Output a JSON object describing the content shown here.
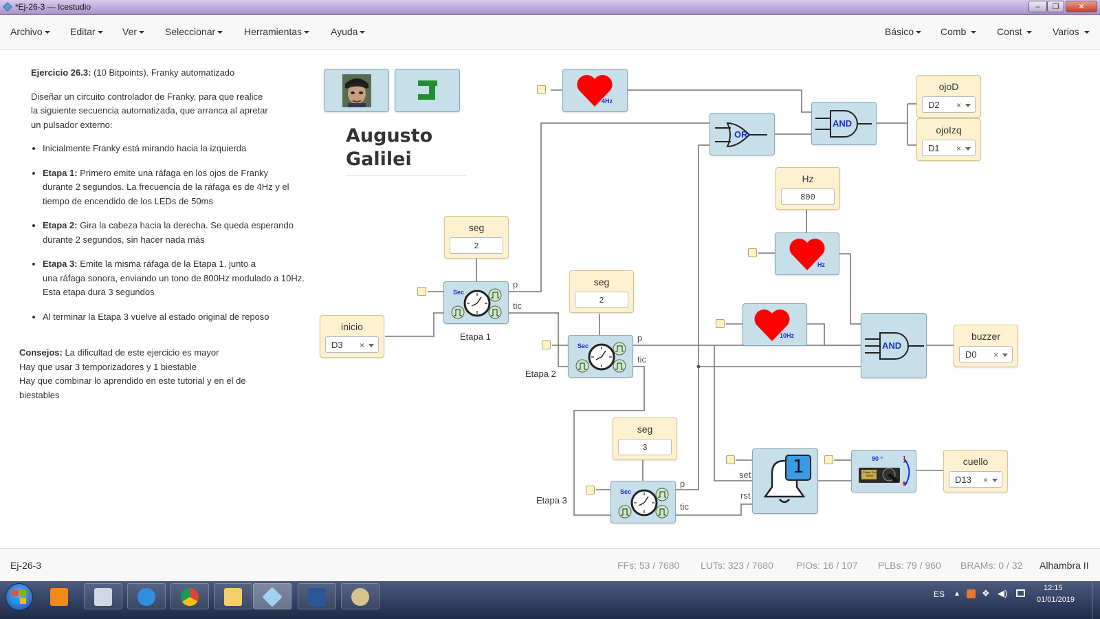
{
  "window": {
    "title": "*Ej-26-3 — Icestudio"
  },
  "menu_left": [
    "Archivo",
    "Editar",
    "Ver",
    "Seleccionar",
    "Herramientas",
    "Ayuda"
  ],
  "menu_right": [
    "Básico",
    "Comb",
    "Const",
    "Varios"
  ],
  "info": {
    "title_bold": "Ejercicio 26.3:",
    "title_rest": " (10 Bitpoints). Franky automatizado",
    "desc_lines": [
      "Diseñar un circuito controlador de Franky, para que realice",
      "la siguiente secuencia automatizada, que arranca al apretar",
      "un pulsador externo:"
    ],
    "bullets": [
      {
        "bold": "",
        "lines": [
          "Inicialmente Franky está mirando hacia la izquierda"
        ]
      },
      {
        "bold": "Etapa 1:",
        "lines": [
          " Primero emite una ráfaga en los ojos de Franky",
          "durante 2 segundos. La frecuencia de la ráfaga es de 4Hz y el",
          "tiempo de encendido de los LEDs de 50ms"
        ]
      },
      {
        "bold": "Etapa 2:",
        "lines": [
          " Gira la cabeza hacia la derecha. Se queda esperando",
          "durante 2 segundos, sin hacer nada más"
        ]
      },
      {
        "bold": "Etapa 3:",
        "lines": [
          " Emite la misma ráfaga de la Etapa 1, junto a",
          "una ráfaga sonora, enviando un tono de 800Hz modulado a 10Hz.",
          "Esta etapa dura 3 segundos"
        ]
      },
      {
        "bold": "",
        "lines": [
          "Al terminar la Etapa 3 vuelve al estado original de reposo"
        ]
      }
    ],
    "advice_bold": "Consejos:",
    "advice_lines": [
      " La dificultad de este ejercicio es mayor",
      "Hay que usar 3 temporizadores y 1 biestable",
      "Hay que combinar lo aprendido en este tutorial y en el de",
      "biestables"
    ]
  },
  "author": {
    "name_line1": "Augusto",
    "name_line2": "Galilei"
  },
  "circuit": {
    "seg1": {
      "label": "seg",
      "value": "2"
    },
    "seg2": {
      "label": "seg",
      "value": "2"
    },
    "seg3": {
      "label": "seg",
      "value": "3"
    },
    "hz": {
      "label": "Hz",
      "value": "800"
    },
    "inicio": {
      "label": "inicio",
      "value": "D3",
      "clear": "×"
    },
    "ojoD": {
      "label": "ojoD",
      "value": "D2",
      "clear": "×"
    },
    "ojoIzq": {
      "label": "ojoIzq",
      "value": "D1",
      "clear": "×"
    },
    "buzzer": {
      "label": "buzzer",
      "value": "D0",
      "clear": "×"
    },
    "cuello": {
      "label": "cuello",
      "value": "D13",
      "clear": "×"
    },
    "timer_sec_label": "Sec",
    "heart_4hz": "4Hz",
    "heart_hz": "Hz",
    "heart_10hz": "10Hz",
    "or_label": "OR",
    "and_label": "AND",
    "port_p": "p",
    "port_tic": "tic",
    "port_set": "set",
    "port_rst": "rst",
    "etapa1": "Etapa 1",
    "etapa2": "Etapa 2",
    "etapa3": "Etapa 3",
    "ff_value": "1",
    "servo_angle": "90 °",
    "servo_text": "Tower Pro SG90",
    "servo_one": "1",
    "servo_zero": "0"
  },
  "status": {
    "project": "Ej-26-3",
    "ffs_label": "FFs:",
    "ffs_value": "53 / 7680",
    "luts_label": "LUTs:",
    "luts_value": "323 / 7680",
    "pios_label": "PIOs:",
    "pios_value": "16 / 107",
    "plbs_label": "PLBs:",
    "plbs_value": "79 / 960",
    "brams_label": "BRAMs:",
    "brams_value": "0 / 32",
    "board": "Alhambra II"
  },
  "taskbar": {
    "lang": "ES",
    "time": "12:15",
    "date": "01/01/2019"
  },
  "colors": {
    "block": "#c6dfe9",
    "constant": "#fdf1cf",
    "wire": "#777777",
    "gate_text": "#1a2fd0",
    "heart": "#ff0000",
    "accent_green": "#1f8f2f"
  }
}
